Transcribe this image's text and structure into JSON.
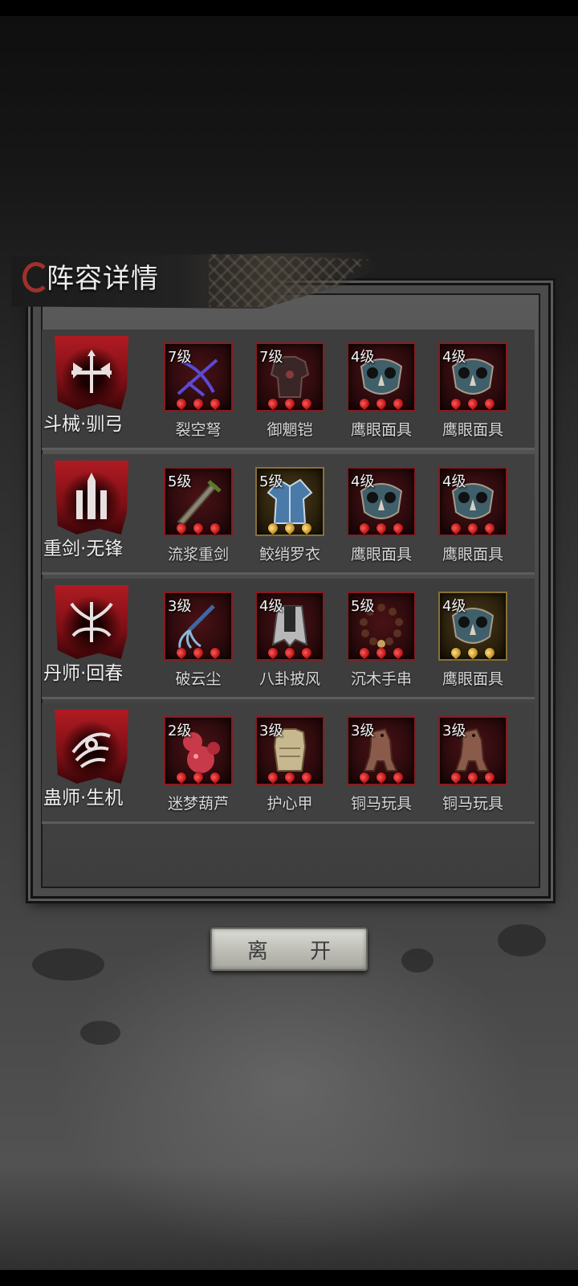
{
  "dialog": {
    "title": "阵容详情",
    "leave_label": "离 开"
  },
  "roster": [
    {
      "hero": "斗械·驯弓",
      "emblem_icon": "crossbow-emblem-icon",
      "equipment": [
        {
          "level": "7级",
          "name": "裂空弩",
          "icon": "crossbow-icon",
          "gem_color": "red"
        },
        {
          "level": "7级",
          "name": "御魍铠",
          "icon": "armor-icon",
          "gem_color": "red"
        },
        {
          "level": "4级",
          "name": "鹰眼面具",
          "icon": "owl-mask-icon",
          "gem_color": "red"
        },
        {
          "level": "4级",
          "name": "鹰眼面具",
          "icon": "owl-mask-icon",
          "gem_color": "red"
        }
      ]
    },
    {
      "hero": "重剑·无锋",
      "emblem_icon": "greatsword-emblem-icon",
      "equipment": [
        {
          "level": "5级",
          "name": "流浆重剑",
          "icon": "greatsword-icon",
          "gem_color": "red"
        },
        {
          "level": "5级",
          "name": "鲛绡罗衣",
          "icon": "robe-icon",
          "gem_color": "gold"
        },
        {
          "level": "4级",
          "name": "鹰眼面具",
          "icon": "owl-mask-icon",
          "gem_color": "red"
        },
        {
          "level": "4级",
          "name": "鹰眼面具",
          "icon": "owl-mask-icon",
          "gem_color": "red"
        }
      ]
    },
    {
      "hero": "丹师·回春",
      "emblem_icon": "healer-emblem-icon",
      "equipment": [
        {
          "level": "3级",
          "name": "破云尘",
          "icon": "whisk-icon",
          "gem_color": "red"
        },
        {
          "level": "4级",
          "name": "八卦披风",
          "icon": "cloak-icon",
          "gem_color": "red"
        },
        {
          "level": "5级",
          "name": "沉木手串",
          "icon": "beads-icon",
          "gem_color": "red"
        },
        {
          "level": "4级",
          "name": "鹰眼面具",
          "icon": "owl-mask-icon",
          "gem_color": "gold"
        }
      ]
    },
    {
      "hero": "蛊师·生机",
      "emblem_icon": "sorcerer-emblem-icon",
      "equipment": [
        {
          "level": "2级",
          "name": "迷梦葫芦",
          "icon": "gourd-icon",
          "gem_color": "red"
        },
        {
          "level": "3级",
          "name": "护心甲",
          "icon": "breastplate-icon",
          "gem_color": "red"
        },
        {
          "level": "3级",
          "name": "铜马玩具",
          "icon": "bronze-horse-icon",
          "gem_color": "red"
        },
        {
          "level": "3级",
          "name": "铜马玩具",
          "icon": "bronze-horse-icon",
          "gem_color": "red"
        }
      ]
    }
  ]
}
